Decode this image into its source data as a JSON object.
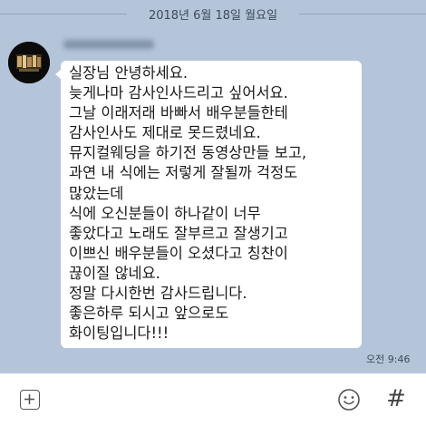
{
  "date_divider": "2018년 6월 18일 월요일",
  "message": {
    "lines": [
      "실장님 안녕하세요.",
      "늦게나마 감사인사드리고 싶어서요.",
      "그날 이래저래 바빠서 배우분들한테",
      "감사인사도 제대로 못드렸네요.",
      "뮤지컬웨딩을 하기전 동영상만들 보고,",
      "과연 내 식에는 저렇게 잘될까 걱정도",
      "많았는데",
      "식에 오신분들이 하나같이 너무",
      "좋았다고 노래도 잘부르고 잘생기고",
      "이쁘신 배우분들이 오셨다고 칭찬이",
      "끊이질 않네요.",
      "정말 다시한번 감사드립니다.",
      "좋은하루 되시고 앞으로도",
      "화이팅입니다!!!"
    ],
    "time": "오전 9:46"
  },
  "input_bar": {
    "icons": [
      "plus-icon",
      "emoji-icon",
      "hash-icon"
    ],
    "hash_glyph": "#"
  },
  "colors": {
    "chat_background": "#b4c5d9",
    "bubble": "#ffffff",
    "input_bar": "#ffffff"
  }
}
